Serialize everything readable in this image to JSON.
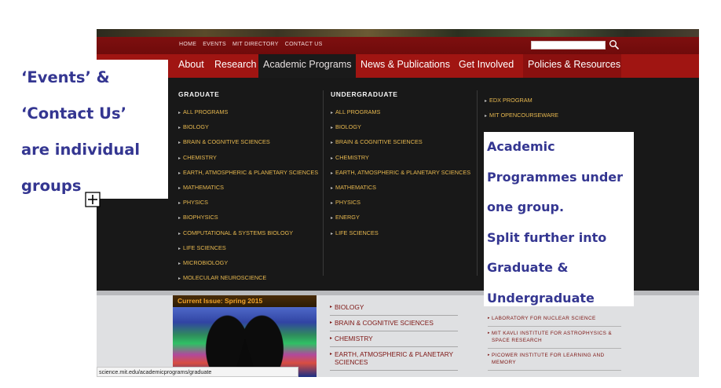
{
  "site": {
    "utility_links": [
      "HOME",
      "EVENTS",
      "MIT DIRECTORY",
      "CONTACT US"
    ],
    "search": {
      "placeholder": "",
      "icon": "search-icon"
    },
    "main_nav": {
      "items": [
        "About",
        "Research",
        "Academic Programs",
        "News & Publications",
        "Get Involved",
        "Policies & Resources"
      ],
      "active": "Academic Programs"
    },
    "mega_menu": {
      "graduate": {
        "heading": "GRADUATE",
        "items": [
          "ALL PROGRAMS",
          "BIOLOGY",
          "BRAIN & COGNITIVE SCIENCES",
          "CHEMISTRY",
          "EARTH, ATMOSPHERIC & PLANETARY SCIENCES",
          "MATHEMATICS",
          "PHYSICS",
          "BIOPHYSICS",
          "COMPUTATIONAL & SYSTEMS BIOLOGY",
          "LIFE SCIENCES",
          "MICROBIOLOGY",
          "MOLECULAR NEUROSCIENCE"
        ]
      },
      "undergraduate": {
        "heading": "UNDERGRADUATE",
        "items": [
          "ALL PROGRAMS",
          "BIOLOGY",
          "BRAIN & COGNITIVE SCIENCES",
          "CHEMISTRY",
          "EARTH, ATMOSPHERIC & PLANETARY SCIENCES",
          "MATHEMATICS",
          "PHYSICS",
          "ENERGY",
          "LIFE SCIENCES"
        ]
      },
      "other": {
        "items": [
          "EDX PROGRAM",
          "MIT OPENCOURSEWARE"
        ]
      }
    },
    "current_issue": {
      "title": "Current Issue: Spring 2015"
    },
    "departments": [
      "BIOLOGY",
      "BRAIN & COGNITIVE SCIENCES",
      "CHEMISTRY",
      "EARTH, ATMOSPHERIC & PLANETARY SCIENCES"
    ],
    "labs": [
      "LABORATORY FOR NUCLEAR SCIENCE",
      "MIT KAVLI INSTITUTE FOR ASTROPHYSICS & SPACE RESEARCH",
      "PICOWER INSTITUTE FOR LEARNING AND MEMORY"
    ],
    "status_url": "science.mit.edu/academicprograms/graduate"
  },
  "annotations": {
    "left_lines": [
      "‘Events’ &",
      "‘Contact Us’",
      "are individual",
      "groups"
    ],
    "right_lines": [
      "Academic",
      "Programmes under",
      "one group.",
      "Split further into",
      "Graduate &",
      "Undergraduate"
    ]
  },
  "colors": {
    "nav_red": "#a01512",
    "utility_red": "#7e0f0f",
    "menu_bg": "#181818",
    "link_gold": "#e7b84f",
    "annotation_text": "#343691"
  }
}
